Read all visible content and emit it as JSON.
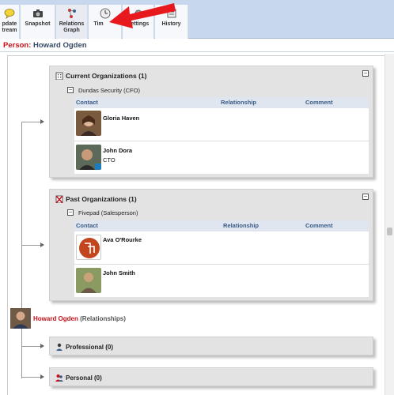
{
  "toolbar": {
    "items": [
      {
        "label_1": "pdate",
        "label_2": "tream",
        "icon": "speech-bubble-icon"
      },
      {
        "label_1": "Snapshot",
        "label_2": "",
        "icon": "camera-icon"
      },
      {
        "label_1": "Relations",
        "label_2": "Graph",
        "icon": "relations-graph-icon"
      },
      {
        "label_1": "Timeline",
        "label_2": "",
        "icon": "clock-icon"
      },
      {
        "label_1": "Settings",
        "label_2": "",
        "icon": "gear-icon"
      },
      {
        "label_1": "History",
        "label_2": "",
        "icon": "history-icon"
      }
    ],
    "timeline_visible": "Tim"
  },
  "person": {
    "label": "Person:",
    "name": "Howard Ogden"
  },
  "current_orgs": {
    "title": "Current Organizations (1)",
    "org": "Dundas Security (CFO)",
    "columns": [
      "Contact",
      "Relationship",
      "Comment"
    ],
    "contacts": [
      {
        "name": "Gloria Haven",
        "title": ""
      },
      {
        "name": "John Dora",
        "title": "CTO"
      }
    ]
  },
  "past_orgs": {
    "title": "Past Organizations (1)",
    "org": "Fivepad (Salesperson)",
    "columns": [
      "Contact",
      "Relationship",
      "Comment"
    ],
    "contacts": [
      {
        "name": "Ava O'Rourke",
        "title": ""
      },
      {
        "name": "John Smith",
        "title": ""
      }
    ]
  },
  "relationships": {
    "name": "Howard Ogden",
    "suffix": "(Relationships)",
    "groups": [
      {
        "label": "Professional (0)"
      },
      {
        "label": "Personal (0)"
      }
    ]
  },
  "colors": {
    "toolbar_bg": "#c6d7ee",
    "accent_red": "#c8111a",
    "header_blue": "#3a5a86"
  }
}
